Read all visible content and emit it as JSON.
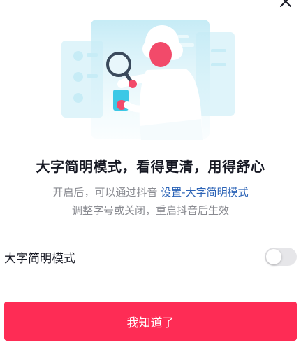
{
  "dialog": {
    "headline": "大字简明模式，看得更清，用得舒心",
    "desc_line1_prefix": "开启后，可以通过抖音 ",
    "desc_line1_link": "设置-大字简明模式",
    "desc_line2": "调整字号或关闭，重启抖音后生效",
    "toggle_label": "大字简明模式",
    "toggle_on": false,
    "confirm_label": "我知道了"
  },
  "colors": {
    "accent": "#fe2c55",
    "link": "#2a62b6",
    "illustration_blue": "#bfe9f5",
    "illustration_pink": "#f24a6a"
  },
  "icons": {
    "close": "close-icon",
    "illustration": "magnifier-scientist-illustration"
  }
}
